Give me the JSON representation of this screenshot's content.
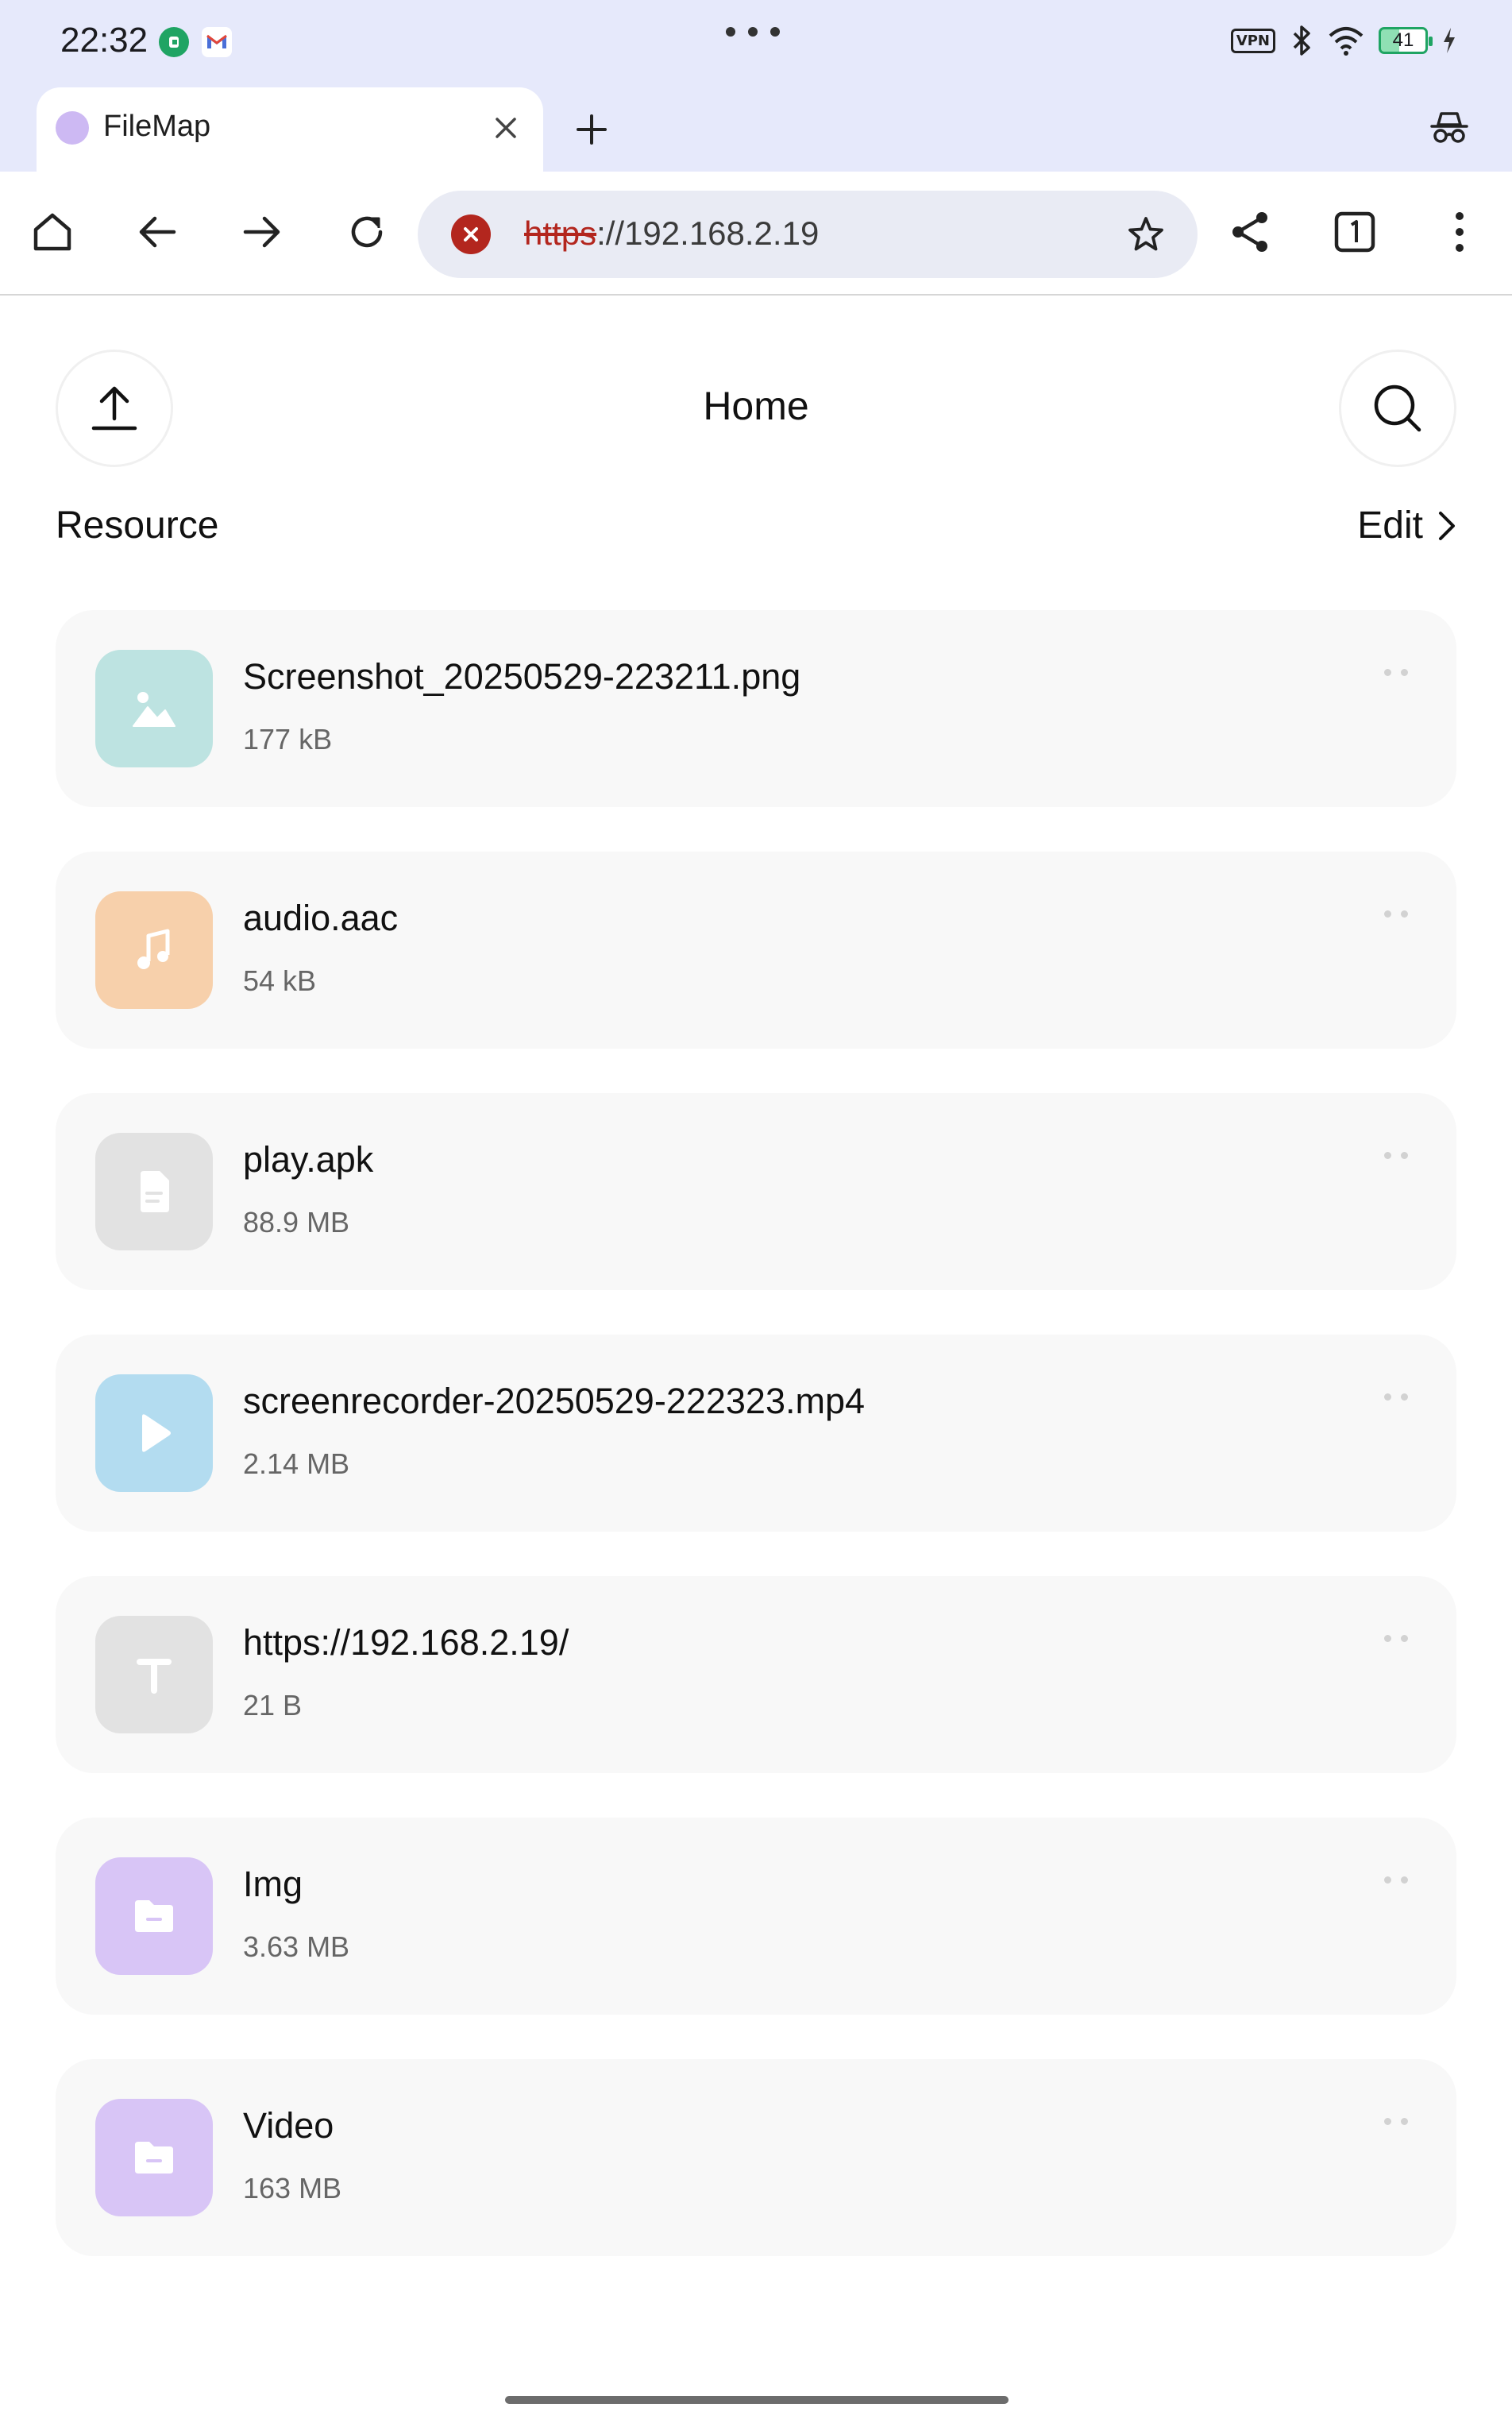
{
  "status_bar": {
    "time": "22:32",
    "notification_icons": [
      "green-app-icon",
      "gmail-icon"
    ],
    "center_dots": "more-dots-icon",
    "vpn": "VPN",
    "battery_level": "41"
  },
  "browser": {
    "tab_title": "FileMap",
    "url_scheme": "https",
    "url_rest": "://192.168.2.19",
    "colors": {
      "chrome_bg": "#e6e9fb",
      "error_red": "#b3261e"
    }
  },
  "page": {
    "title": "Home",
    "section_title": "Resource",
    "edit_label": "Edit",
    "files": [
      {
        "name": "Screenshot_20250529-223211.png",
        "size": "177 kB",
        "icon": "image-icon",
        "color": "#bde3e1"
      },
      {
        "name": "audio.aac",
        "size": "54 kB",
        "icon": "music-icon",
        "color": "#f7d0ab"
      },
      {
        "name": "play.apk",
        "size": "88.9 MB",
        "icon": "document-icon",
        "color": "#e2e2e2"
      },
      {
        "name": "screenrecorder-20250529-222323.mp4",
        "size": "2.14 MB",
        "icon": "play-icon",
        "color": "#b3dcf0"
      },
      {
        "name": "https://192.168.2.19/",
        "size": "21 B",
        "icon": "text-icon",
        "color": "#e2e2e2"
      },
      {
        "name": "Img",
        "size": "3.63 MB",
        "icon": "folder-icon",
        "color": "#d8c5f6"
      },
      {
        "name": "Video",
        "size": "163 MB",
        "icon": "folder-icon",
        "color": "#d8c5f6"
      }
    ]
  }
}
